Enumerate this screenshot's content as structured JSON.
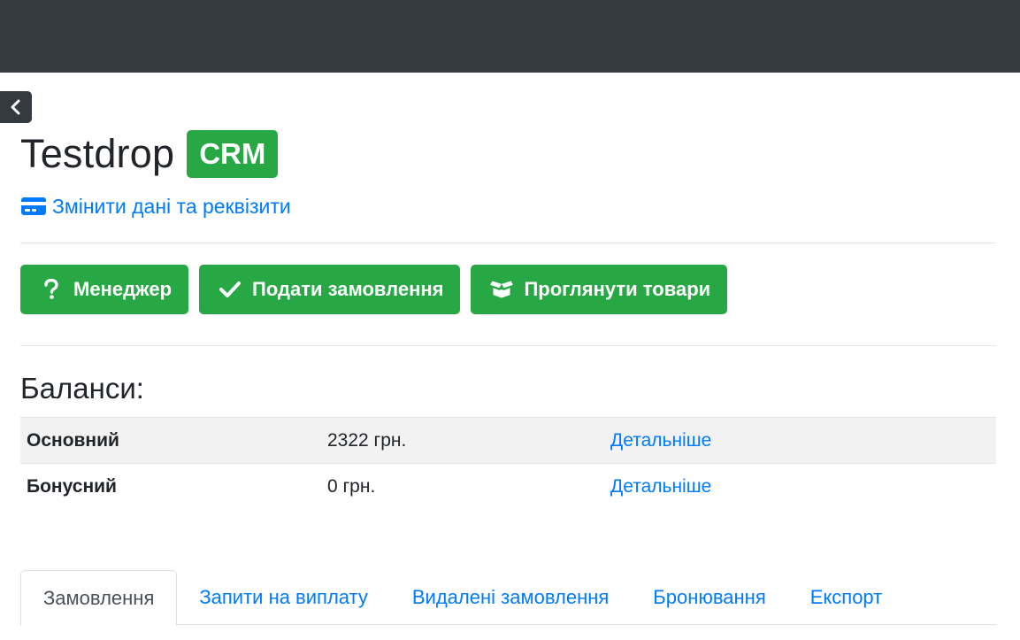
{
  "header": {
    "title": "Testdrop",
    "badge": "CRM",
    "edit_link": "Змінити дані та реквізити"
  },
  "actions": {
    "manager": "Менеджер",
    "submit_order": "Подати замовлення",
    "view_products": "Проглянути товари"
  },
  "balances": {
    "title": "Баланси:",
    "rows": [
      {
        "name": "Основний",
        "amount": "2322 грн.",
        "link": "Детальніше"
      },
      {
        "name": "Бонусний",
        "amount": "0 грн.",
        "link": "Детальніше"
      }
    ]
  },
  "tabs": [
    {
      "label": "Замовлення",
      "active": true
    },
    {
      "label": "Запити на виплату",
      "active": false
    },
    {
      "label": "Видалені замовлення",
      "active": false
    },
    {
      "label": "Бронювання",
      "active": false
    },
    {
      "label": "Експорт",
      "active": false
    }
  ],
  "colors": {
    "topbar": "#343a40",
    "accent_green": "#28a745",
    "link_blue": "#007bff"
  },
  "icons": {
    "back": "chevron-left-icon",
    "edit": "credit-card-icon",
    "manager": "question-icon",
    "submit": "check-icon",
    "products": "box-open-icon"
  }
}
